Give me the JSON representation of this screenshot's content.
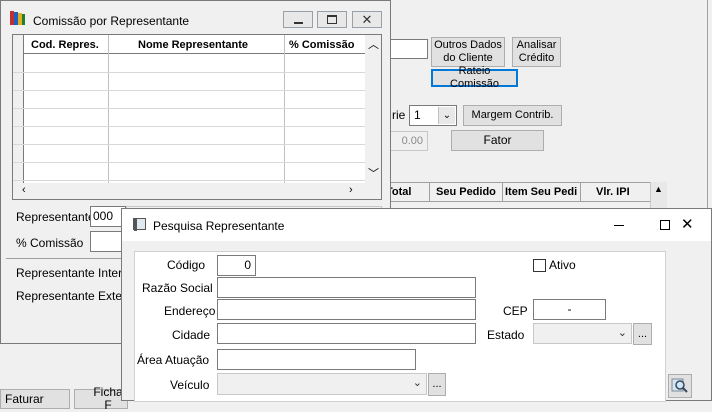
{
  "bg_form": {
    "buttons": {
      "outros_dados": "Outros Dados\ndo Cliente",
      "analisar_credito": "Analisar\nCrédito",
      "rateio": "Rateio Comissão",
      "margem": "Margem Contrib.",
      "fator": "Fator"
    },
    "serie_label": "rie",
    "serie_value": "1",
    "value_field": "0.00",
    "grid_headers": [
      "Total",
      "Seu Pedido",
      "Item Seu Pedi",
      "Vlr. IPI"
    ],
    "bottom_buttons": [
      "Faturar",
      "Ficha F"
    ]
  },
  "comissao_window": {
    "title": "Comissão por Representante",
    "columns": [
      "Cod. Repres.",
      "Nome Representante",
      "% Comissão"
    ],
    "representante_label": "Representante",
    "representante_value": "000",
    "comissao_label": "% Comissão",
    "rep_interno_label": "Representante Interno",
    "rep_externo_label": "Representante Externo"
  },
  "pesquisa_window": {
    "title": "Pesquisa Representante",
    "codigo_label": "Código",
    "codigo_value": "0",
    "ativo_label": "Ativo",
    "razao_label": "Razão Social",
    "endereco_label": "Endereço",
    "cep_label": "CEP",
    "cep_value": "-",
    "cidade_label": "Cidade",
    "estado_label": "Estado",
    "area_label": "Área Atuação",
    "veiculo_label": "Veículo",
    "ellipsis": "..."
  },
  "colors": {
    "window_bg": "#f0f0f0",
    "field_border": "#7a7a7a",
    "highlight_border": "#0078d7"
  }
}
